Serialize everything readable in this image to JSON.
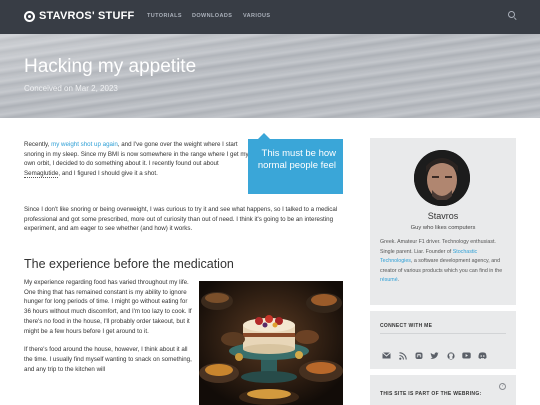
{
  "site": {
    "name": "STAVROS' STUFF",
    "nav": [
      "TUTORIALS",
      "DOWNLOADS",
      "VARIOUS"
    ]
  },
  "post": {
    "title": "Hacking my appetite",
    "date": "Conceived on Mar 2, 2023",
    "p1_a": "Recently, ",
    "p1_link": "my weight shot up again",
    "p1_b": ", and I've gone over the weight where I start snoring in my sleep. Since my BMI is now somewhere in the range where I get my own orbit, I decided to do something about it. I recently found out about ",
    "p1_term": "Semaglutide",
    "p1_c": ", and I figured I should give it a shot.",
    "p2": "Since I don't like snoring or being overweight, I was curious to try it and see what happens, so I talked to a medical professional and got some prescribed, more out of curiosity than out of need. I think it's going to be an interesting experiment, and am eager to see whether (and how) it works.",
    "h2": "The experience before the medication",
    "p3": "My experience regarding food has varied throughout my life. One thing that has remained constant is my ability to ignore hunger for long periods of time. I might go without eating for 36 hours without much discomfort, and I'm too lazy to cook. If there's no food in the house, I'll probably order takeout, but it might be a few hours before I get around to it.",
    "p4": "If there's food around the house, however, I think about it all the time. I usually find myself wanting to snack on something, and any trip to the kitchen will",
    "pullquote": "This must be how normal people feel"
  },
  "sidebar": {
    "author_name": "Stavros",
    "author_tagline": "Guy who likes computers",
    "bio_a": "Greek. Amateur F1 driver. Technology enthusiast. Single parent. Liar. Founder of ",
    "bio_link1": "Stochastic Technologies",
    "bio_b": ", a software development agency, and creator of various products which you can find in the ",
    "bio_link2": "résumé",
    "bio_c": ".",
    "connect_title": "CONNECT WITH ME",
    "social_icons": [
      "email-icon",
      "rss-icon",
      "mastodon-icon",
      "twitter-icon",
      "github-icon",
      "youtube-icon",
      "discord-icon"
    ],
    "webring_title": "THIS SITE IS PART OF THE WEBRING:",
    "webring_help": "?"
  },
  "colors": {
    "topbar": "#383d45",
    "accent": "#3aa6d8",
    "link": "#2d9fd6",
    "sidebar_card": "#e9eaeb"
  }
}
